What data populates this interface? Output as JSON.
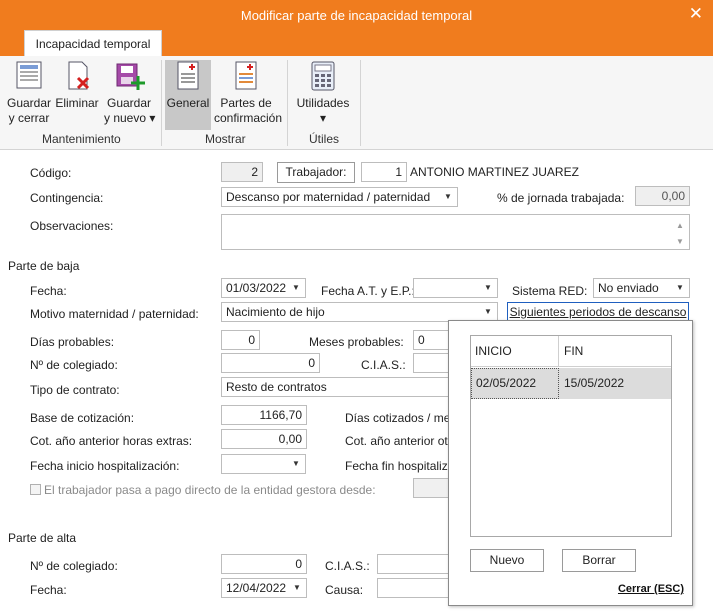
{
  "window": {
    "title": "Modificar parte de incapacidad temporal",
    "close_glyph": "✕"
  },
  "ribbon": {
    "tab_label": "Incapacidad temporal",
    "buttons": {
      "guardar_cerrar": "Guardar\ny cerrar",
      "eliminar": "Eliminar",
      "guardar_nuevo": "Guardar\ny nuevo ▾",
      "general": "General",
      "partes_confirmacion": "Partes de\nconfirmación",
      "utilidades": "Utilidades\n▾"
    },
    "groups": {
      "mantenimiento": "Mantenimiento",
      "mostrar": "Mostrar",
      "utiles": "Útiles"
    }
  },
  "form": {
    "codigo_label": "Código:",
    "codigo_value": "2",
    "trabajador_button": "Trabajador:",
    "trabajador_code": "1",
    "trabajador_name": "ANTONIO MARTINEZ JUAREZ",
    "contingencia_label": "Contingencia:",
    "contingencia_value": "Descanso por maternidad / paternidad",
    "jornada_label": "% de jornada trabajada:",
    "jornada_value": "0,00",
    "observaciones_label": "Observaciones:",
    "parte_baja_title": "Parte de baja",
    "fecha_label": "Fecha:",
    "fecha_value": "01/03/2022",
    "fecha_at_label": "Fecha A.T. y E.P.:",
    "sistema_red_label": "Sistema RED:",
    "sistema_red_value": "No enviado",
    "motivo_label": "Motivo maternidad / paternidad:",
    "motivo_value": "Nacimiento de hijo",
    "siguientes_button": "Siguientes periodos de descanso",
    "dias_probables_label": "Días probables:",
    "dias_probables_value": "0",
    "meses_probables_label": "Meses probables:",
    "meses_probables_value": "0",
    "colegiado_label": "Nº de colegiado:",
    "colegiado_value": "0",
    "cias_label": "C.I.A.S.:",
    "tipo_contrato_label": "Tipo de contrato:",
    "tipo_contrato_value": "Resto de contratos",
    "base_label": "Base de cotización:",
    "base_value": "1166,70",
    "dias_cotizados_label": "Días cotizados / mes",
    "cot_horas_label": "Cot. año anterior horas extras:",
    "cot_horas_value": "0,00",
    "cot_otras_label": "Cot. año anterior otr",
    "hosp_inicio_label": "Fecha inicio hospitalización:",
    "hosp_fin_label": "Fecha fin hospitaliza",
    "pago_directo_label": "El trabajador pasa a pago directo de la entidad gestora desde:",
    "parte_alta_title": "Parte de alta",
    "alta_colegiado_label": "Nº de colegiado:",
    "alta_colegiado_value": "0",
    "alta_cias_label": "C.I.A.S.:",
    "alta_fecha_label": "Fecha:",
    "alta_fecha_value": "12/04/2022",
    "causa_label": "Causa:"
  },
  "popup": {
    "columns": [
      "INICIO",
      "FIN"
    ],
    "rows": [
      {
        "inicio": "02/05/2022",
        "fin": "15/05/2022"
      }
    ],
    "nuevo_button": "Nuevo",
    "borrar_button": "Borrar",
    "cerrar_link": "Cerrar (ESC)"
  },
  "icons": {
    "save_close": "save-close-icon",
    "delete": "delete-icon",
    "save_new": "save-new-icon",
    "general": "document-icon",
    "confirm": "document-list-icon",
    "utilities": "calculator-icon",
    "dropdown": "chevron-down-icon"
  },
  "colors": {
    "titlebar": "#f07c1e",
    "active_ribbon": "#c8c8c8",
    "selected_row": "#dcdcdc",
    "focus_border": "#1f5fbf"
  }
}
